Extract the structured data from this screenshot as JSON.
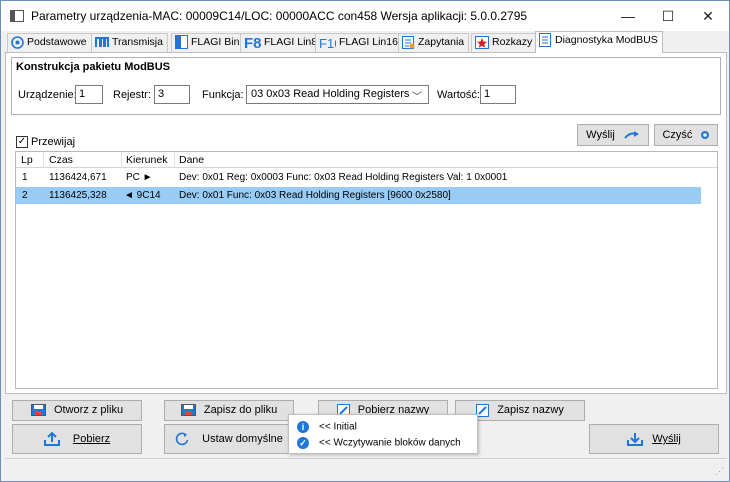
{
  "window": {
    "title": "Parametry urządzenia-MAC: 00009C14/LOC: 00000ACC con458 Wersja aplikacji: 5.0.0.2795",
    "minimize": "—",
    "maximize": "☐",
    "close": "✕"
  },
  "tabs": [
    {
      "label": "Podstawowe",
      "icon": "gear-icon"
    },
    {
      "label": "Transmisja",
      "icon": "transmission-icon"
    },
    {
      "label": "FLAGI Bin",
      "icon": "flag-bin-icon"
    },
    {
      "label": "FLAGI Lin8",
      "icon": "f8-icon"
    },
    {
      "label": "FLAGI Lin16",
      "icon": "f16-icon"
    },
    {
      "label": "Zapytania",
      "icon": "query-icon"
    },
    {
      "label": "Rozkazy",
      "icon": "command-star-icon"
    },
    {
      "label": "Diagnostyka ModBUS",
      "icon": "diagnostic-icon"
    }
  ],
  "packet": {
    "title": "Konstrukcja pakietu ModBUS",
    "device_label": "Urządzenie:",
    "device_value": "1",
    "register_label": "Rejestr:",
    "register_value": "3",
    "function_label": "Funkcja:",
    "function_value": "03 0x03 Read Holding Registers",
    "value_label": "Wartość:",
    "value_value": "1"
  },
  "scroll": {
    "label": "Przewijaj",
    "checked": "✓"
  },
  "actions": {
    "send": "Wyślij",
    "clear": "Czyść"
  },
  "grid": {
    "columns": [
      "Lp",
      "Czas",
      "Kierunek",
      "Dane"
    ],
    "rows": [
      {
        "lp": "1",
        "time": "1136424,671",
        "dir": "PC ►",
        "data": "Dev: 0x01 Reg: 0x0003 Func: 0x03 Read Holding Registers Val: 1 0x0001"
      },
      {
        "lp": "2",
        "time": "1136425,328",
        "dir": "◄ 9C14",
        "data": "Dev: 0x01 Func: 0x03 Read Holding Registers [9600 0x2580]"
      }
    ]
  },
  "bottom": {
    "open_file": "Otworz z pliku",
    "save_file": "Zapisz do pliku",
    "get_names": "Pobierz nazwy",
    "save_names": "Zapisz nazwy",
    "download": "Pobierz",
    "set_default": "Ustaw domyślne",
    "send": "Wyślij"
  },
  "popup": {
    "line1": "<< Initial",
    "line2": "<< Wczytywanie bloków danych"
  },
  "colors": {
    "accent": "#1e77d8",
    "selection": "#99ccf5"
  }
}
